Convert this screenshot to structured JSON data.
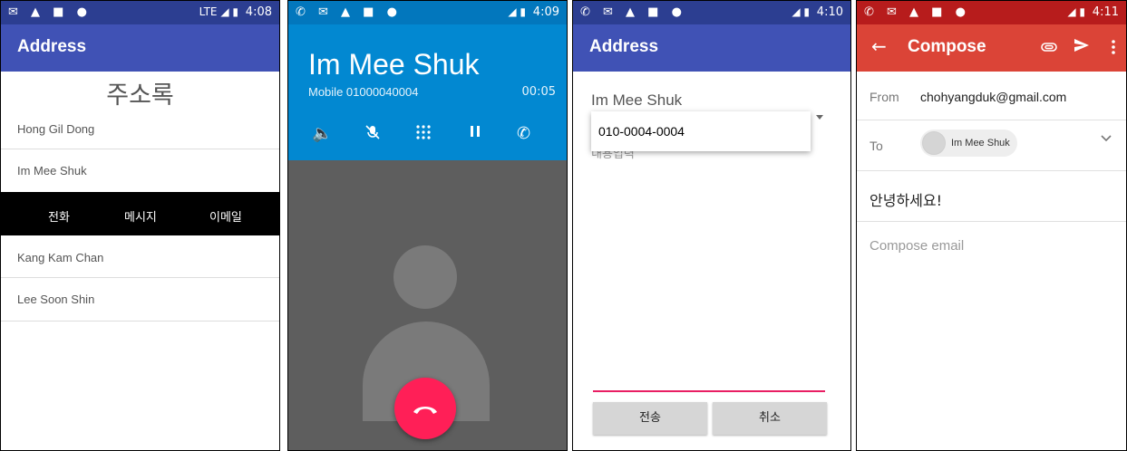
{
  "screens": [
    {
      "status": {
        "icons": "✉ ▲ ■ ●",
        "signal": "LTE ◢ ▮",
        "time": "4:08"
      },
      "appbar_title": "Address",
      "heading": "주소록",
      "contacts": [
        "Hong Gil Dong",
        "Im Mee Shuk",
        "Kang Kam Chan",
        "Lee Soon Shin"
      ],
      "actions": [
        "전화",
        "메시지",
        "이메일"
      ]
    },
    {
      "status": {
        "icons": "✆ ✉ ▲ ■ ●",
        "signal": "◢ ▮",
        "time": "4:09"
      },
      "caller_name": "Im Mee Shuk",
      "caller_detail": "Mobile 01000040004",
      "timer": "00:05",
      "controls": [
        "speaker-icon",
        "mute-icon",
        "dialpad-icon",
        "pause-icon",
        "add-call-icon"
      ],
      "hangup_icon": "phone-hangup-icon"
    },
    {
      "status": {
        "icons": "✆ ✉ ▲ ■ ●",
        "signal": "◢ ▮",
        "time": "4:10"
      },
      "appbar_title": "Address",
      "recipient": "Im Mee Shuk",
      "dropdown_option": "010-0004-0004",
      "message_hint": "내용입력",
      "send_label": "전송",
      "cancel_label": "취소"
    },
    {
      "status": {
        "icons": "✆ ✉ ▲ ■ ●",
        "signal": "◢ ▮",
        "time": "4:11"
      },
      "appbar_title": "Compose",
      "from_label": "From",
      "from_value": "chohyangduk@gmail.com",
      "to_label": "To",
      "to_chip": "Im Mee Shuk",
      "subject": "안녕하세요!",
      "body_placeholder": "Compose email"
    }
  ],
  "colors": {
    "indigo_primary": "#4052b5",
    "indigo_dark": "#2c3e91",
    "dialer_blue": "#0288d1",
    "hangup_red": "#ff1f57",
    "gmail_red": "#db4437",
    "accent_pink": "#e91e63"
  }
}
